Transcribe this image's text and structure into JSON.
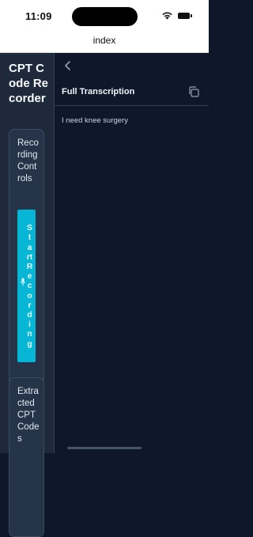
{
  "status_bar": {
    "time": "11:09"
  },
  "nav": {
    "title": "index"
  },
  "sidebar": {
    "app_title": "CPT Code Recorder",
    "recording_card": {
      "title": "Recording Controls",
      "start_button_label": "Start Recording"
    },
    "codes_card": {
      "title": "Extracted CPT Codes"
    }
  },
  "main": {
    "section_title": "Full Transcription",
    "transcription_text": "I need knee surgery"
  },
  "colors": {
    "background": "#0f172a",
    "sidebar": "#1e293b",
    "accent": "#06b6d4"
  },
  "icons": {
    "back": "chevron-left-icon",
    "copy": "copy-icon",
    "mic": "microphone-icon",
    "wifi": "wifi-icon",
    "battery": "battery-icon"
  }
}
